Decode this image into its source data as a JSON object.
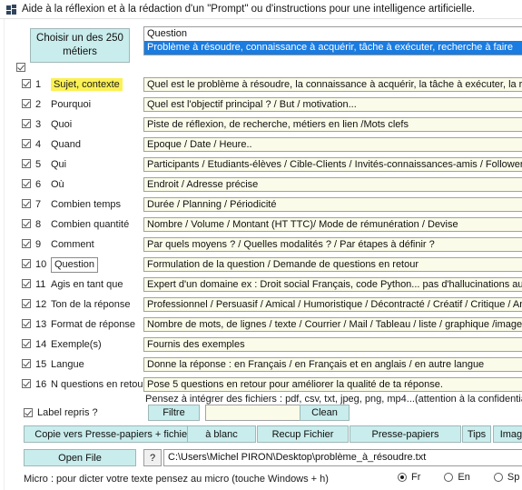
{
  "window": {
    "title": "Aide à la réflexion et à la rédaction d'un \"Prompt\" ou d'instructions pour une intelligence artificielle.",
    "icon": "app-icon"
  },
  "top": {
    "metier_button": "Choisir un des  250 métiers",
    "global_checkbox_checked": true,
    "question_header": "Question",
    "question_selected": "Problème à résoudre, connaissance à acquérir, tâche à exécuter, recherche à faire",
    "selection_color": "#1a7be0"
  },
  "rows": [
    {
      "num": "1",
      "label": "Sujet, contexte",
      "checked": true,
      "style": "highlight",
      "value": "Quel est le problème à résoudre, la connaissance à acquérir, la tâche à exécuter, la recherche à faire"
    },
    {
      "num": "2",
      "label": "Pourquoi",
      "checked": true,
      "style": "plain",
      "value": "Quel est l'objectif principal ? / But / motivation..."
    },
    {
      "num": "3",
      "label": "Quoi",
      "checked": true,
      "style": "plain",
      "value": "Piste de réflexion, de recherche, métiers en lien /Mots clefs"
    },
    {
      "num": "4",
      "label": "Quand",
      "checked": true,
      "style": "plain",
      "value": "Epoque / Date / Heure.."
    },
    {
      "num": "5",
      "label": "Qui",
      "checked": true,
      "style": "plain",
      "value": "Participants / Etudiants-élèves / Cible-Clients / Invités-connaissances-amis / Followers / Réseau social"
    },
    {
      "num": "6",
      "label": "Où",
      "checked": true,
      "style": "plain",
      "value": "Endroit / Adresse précise"
    },
    {
      "num": "7",
      "label": "Combien temps",
      "checked": true,
      "style": "plain",
      "value": "Durée / Planning / Périodicité"
    },
    {
      "num": "8",
      "label": "Combien quantité",
      "checked": true,
      "style": "plain",
      "value": "Nombre / Volume / Montant (HT TTC)/ Mode de rémunération / Devise"
    },
    {
      "num": "9",
      "label": "Comment",
      "checked": true,
      "style": "plain",
      "value": "Par quels moyens ? / Quelles modalités ? / Par étapes à définir ?"
    },
    {
      "num": "10",
      "label": "Question",
      "checked": true,
      "style": "boxed",
      "value": "Formulation de la question / Demande de questions en retour"
    },
    {
      "num": "11",
      "label": "Agis en tant que",
      "checked": true,
      "style": "plain",
      "value": "Expert d'un domaine ex : Droit social Français, code Python... pas d'hallucinations autorisées."
    },
    {
      "num": "12",
      "label": "Ton de la réponse",
      "checked": true,
      "style": "plain",
      "value": "Professionnel / Persuasif / Amical / Humoristique / Décontracté / Créatif / Critique / Analytique..."
    },
    {
      "num": "13",
      "label": "Format de réponse",
      "checked": true,
      "style": "plain",
      "value": "Nombre de mots, de lignes / texte / Courrier / Mail / Tableau / liste / graphique /image/ Document"
    },
    {
      "num": "14",
      "label": "Exemple(s)",
      "checked": true,
      "style": "plain",
      "value": "Fournis des exemples"
    },
    {
      "num": "15",
      "label": "Langue",
      "checked": true,
      "style": "plain",
      "value": "Donne la réponse : en Français / en Français et en anglais / en autre langue"
    },
    {
      "num": "16",
      "label": "N questions en retour",
      "checked": true,
      "style": "plain",
      "value": "Pose 5 questions en retour pour améliorer la qualité de ta réponse."
    }
  ],
  "hint": "Pensez à intégrer des fichiers : pdf, csv, txt, jpeg, png, mp4...(attention à la confidentialité et au secret)",
  "filter_row": {
    "label_repris": "Label repris ?",
    "label_repris_checked": true,
    "filtre_button": "Filtre",
    "filter_value": "",
    "filter_placeholder": "",
    "clean_button": "Clean"
  },
  "actions": {
    "copie": "Copie vers Presse-papiers + fichier",
    "a_blanc": "à blanc",
    "recup_fichier": "Recup Fichier",
    "presse_papiers": "Presse-papiers",
    "tips": "Tips",
    "image": "Image"
  },
  "file_row": {
    "open_file": "Open File",
    "help": "?",
    "path": "C:\\Users\\Michel PIRON\\Desktop\\problème_à_résoudre.txt"
  },
  "footer": {
    "micro_text": "Micro : pour dicter votre texte pensez au micro (touche Windows + h)",
    "languages": [
      {
        "code": "Fr",
        "selected": true
      },
      {
        "code": "En",
        "selected": false
      },
      {
        "code": "Sp",
        "selected": false
      }
    ]
  },
  "colors": {
    "button_bg": "#c9ecec",
    "field_bg": "#fbfbe9",
    "highlight": "#fcf153",
    "selection": "#1a7be0"
  }
}
